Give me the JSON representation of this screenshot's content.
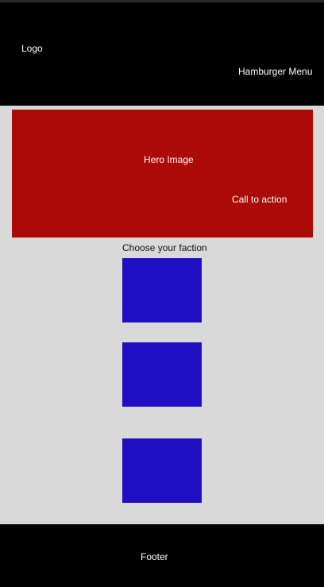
{
  "header": {
    "logo_text": "Logo",
    "menu_label": "Hamburger Menu"
  },
  "hero": {
    "image_label": "Hero Image",
    "cta_label": "Call to action"
  },
  "factions": {
    "heading": "Choose your faction",
    "cards": 3
  },
  "footer": {
    "label": "Footer"
  },
  "colors": {
    "header_bg": "#000000",
    "page_bg": "#d9d9d9",
    "hero_bg": "#ab0a06",
    "card_bg": "#1e0ec4",
    "footer_bg": "#000000",
    "text_light": "#ffffff",
    "text_dark": "#111111"
  }
}
